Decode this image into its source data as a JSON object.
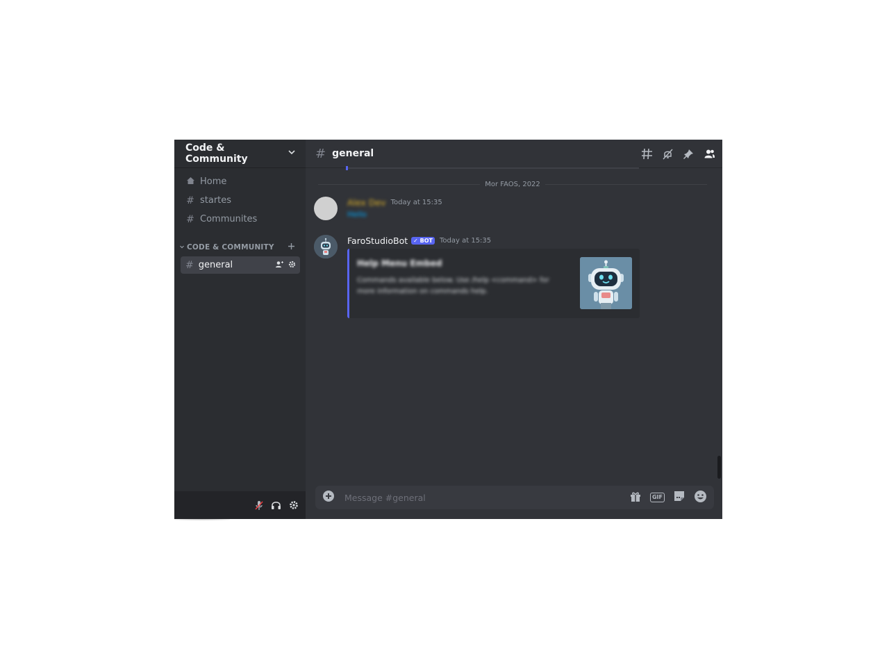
{
  "server": {
    "name": "Code & Community"
  },
  "nav": [
    {
      "label": "Home",
      "icon": "home-icon"
    },
    {
      "label": "startes",
      "icon": "hash-icon"
    },
    {
      "label": "Communites",
      "icon": "hash-icon"
    }
  ],
  "category": {
    "label": "CODE & COMMUNITY"
  },
  "active_channel": {
    "name": "general"
  },
  "header": {
    "channel": "general"
  },
  "date_divider": "Mor FAOS, 2022",
  "messages": [
    {
      "author": "Alex Dev",
      "time": "Today at 15:35",
      "text": "Hello",
      "author_color": "#e0b32a",
      "text_color": "#00a8fc"
    },
    {
      "author": "FaroStudioBot",
      "badge": "✓ BOT",
      "time": "Today at 15:35",
      "embed": {
        "title": "Help Menu Embed",
        "description": "Commands available below. Use /help <command> for more information on commands help."
      }
    }
  ],
  "composer": {
    "placeholder": "Message #general"
  },
  "colors": {
    "accent": "#5865f2",
    "sidebar": "#2b2d31",
    "main": "#313338",
    "muted_mic": "#f23f43"
  }
}
